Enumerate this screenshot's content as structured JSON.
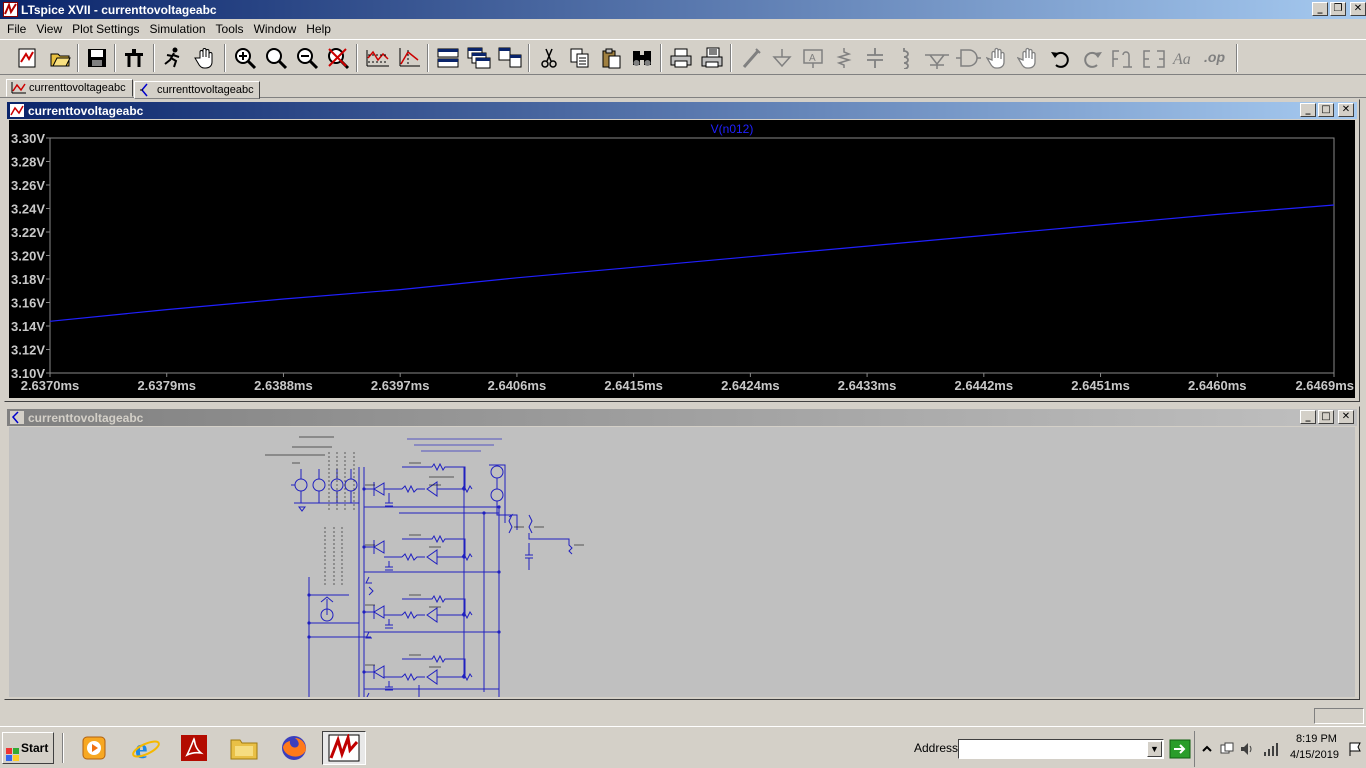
{
  "window": {
    "title": "LTspice XVII - currenttovoltageabc"
  },
  "menu": [
    "File",
    "View",
    "Plot Settings",
    "Simulation",
    "Tools",
    "Window",
    "Help"
  ],
  "toolbar": {
    "icons": [
      "new-schematic-icon",
      "open-icon",
      "save-icon",
      "control-panel-icon",
      "run-icon",
      "halt-icon",
      "zoom-in-icon",
      "zoom-fit-icon",
      "zoom-out-icon",
      "zoom-cancel-icon",
      "autorange-icon",
      "manual-limits-icon",
      "tile-horizontal-icon",
      "cascade-icon",
      "tile-vertical-icon",
      "cut-icon",
      "copy-icon",
      "paste-icon",
      "find-icon",
      "print-icon",
      "print-preview-icon",
      "draw-wire-icon",
      "ground-icon",
      "label-net-icon",
      "resistor-icon",
      "capacitor-icon",
      "inductor-icon",
      "diode-icon",
      "component-icon",
      "move-icon",
      "drag-icon",
      "undo-icon",
      "redo-icon",
      "rotate-icon",
      "mirror-icon",
      "text-icon",
      "spice-directive-icon"
    ]
  },
  "tabs": [
    {
      "label": "currenttovoltageabc",
      "icon": "waveform-icon"
    },
    {
      "label": "currenttovoltageabc",
      "icon": "schematic-icon"
    }
  ],
  "plot_window": {
    "title": "currenttovoltageabc"
  },
  "schematic_window": {
    "title": "currenttovoltageabc"
  },
  "colors": {
    "trace": "#2020ff",
    "plot_background": "#000000",
    "axis_text": "#c8c8c8",
    "wire": "#2020c0",
    "titlebar": "#0a246a"
  },
  "chart_data": {
    "type": "line",
    "title": "V(n012)",
    "xlabel": "",
    "ylabel": "",
    "xlim": [
      2.637,
      2.6469
    ],
    "ylim": [
      3.1,
      3.3
    ],
    "grid": false,
    "x_ticks": [
      "2.6370ms",
      "2.6379ms",
      "2.6388ms",
      "2.6397ms",
      "2.6406ms",
      "2.6415ms",
      "2.6424ms",
      "2.6433ms",
      "2.6442ms",
      "2.6451ms",
      "2.6460ms",
      "2.6469ms"
    ],
    "y_ticks": [
      "3.30V",
      "3.28V",
      "3.26V",
      "3.24V",
      "3.22V",
      "3.20V",
      "3.18V",
      "3.16V",
      "3.14V",
      "3.12V",
      "3.10V"
    ],
    "series": [
      {
        "name": "V(n012)",
        "x": [
          2.637,
          2.6379,
          2.6388,
          2.6397,
          2.6406,
          2.6415,
          2.6424,
          2.6433,
          2.6442,
          2.6451,
          2.646,
          2.6469
        ],
        "values": [
          3.144,
          3.154,
          3.163,
          3.171,
          3.181,
          3.19,
          3.199,
          3.208,
          3.217,
          3.226,
          3.235,
          3.243
        ]
      }
    ]
  },
  "taskbar": {
    "start_label": "Start",
    "apps": [
      "media-player-icon",
      "internet-explorer-icon",
      "acrobat-icon",
      "file-explorer-icon",
      "firefox-icon",
      "ltspice-icon"
    ],
    "address_label": "Address",
    "address_value": "",
    "time": "8:19 PM",
    "date": "4/15/2019"
  }
}
